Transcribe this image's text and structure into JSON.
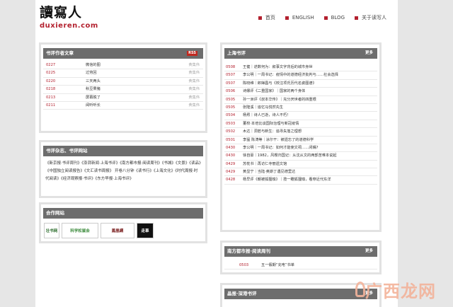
{
  "site": {
    "logo_cn": "讀寫人",
    "logo_en": "duxieren.com"
  },
  "nav": [
    {
      "label": "首页"
    },
    {
      "label": "ENGLISH"
    },
    {
      "label": "BLOG"
    },
    {
      "label": "关于读写人"
    }
  ],
  "reviews": {
    "title": "书评作者文章",
    "rss": "RSS",
    "items": [
      {
        "date": "0227",
        "title": "微信的图",
        "author": "黄集伟"
      },
      {
        "date": "0225",
        "title": "过劳回",
        "author": "黄集伟"
      },
      {
        "date": "0220",
        "title": "三天两头",
        "author": "黄集伟"
      },
      {
        "date": "0218",
        "title": "秋豆果猪",
        "author": "黄集伟"
      },
      {
        "date": "0213",
        "title": "屏幕脱了",
        "author": "黄集伟"
      },
      {
        "date": "0211",
        "title": "阅听听长",
        "author": "黄集伟"
      }
    ]
  },
  "magazines": {
    "title": "书评杂志、书评网站",
    "text": "《新京报·书评周刊》《澎湃新闻·上海书评》《南方都市报·阅读周刊》《书城》《文景》《读品》《中国独立阅读报告》《文汇读书周报》 开卷八分钟《读书行》《上海文化》《时代周报·时代阅读》《经济观察报·书评》《东方早报·上海书评》"
  },
  "partners": {
    "title": "合作网站",
    "items": [
      {
        "label": "壮书网"
      },
      {
        "label": "科学松鼠会"
      },
      {
        "label": "鳳凰網"
      },
      {
        "label": "走車"
      }
    ]
  },
  "shanghai": {
    "title": "上海书评",
    "more": "更多",
    "items": [
      {
        "date": "0508",
        "title": "王健｜述数何为：叙事文字背后的城市身世"
      },
      {
        "date": "0507",
        "title": "李公明｜一周书记：疫情中的道德经济批判与……社会选择"
      },
      {
        "date": "0507",
        "title": "陈晓维｜郎婵昌与《校注项氏历代名瓷图谱》"
      },
      {
        "date": "0506",
        "title": "诗娜评《二重国家》｜国家的两个身体"
      },
      {
        "date": "0505",
        "title": "孙一洲评《叔本华传》｜充分厌世者的四重根"
      },
      {
        "date": "0505",
        "title": "张隆溪｜追忆马悦然先生"
      },
      {
        "date": "0504",
        "title": "杨焄｜诗人已逝，诗人不朽！"
      },
      {
        "date": "0503",
        "title": "董校·本培比谈国际治理与新冠疫情"
      },
      {
        "date": "0502",
        "title": "木达｜洞若与新生：追寻失落之理想"
      },
      {
        "date": "0501",
        "title": "李猛 陈涛等｜涂尔干：被遗忘了的道德科学"
      },
      {
        "date": "0430",
        "title": "李公明｜一周书记：如何才能使文祠……闭嘴?"
      },
      {
        "date": "0430",
        "title": "徐自豪｜1982，风樱归国记：从沈从文的两部苦难本说起"
      },
      {
        "date": "0429",
        "title": "苏枕书｜再访仁寺丽遗文馆"
      },
      {
        "date": "0429",
        "title": "黄显宁｜当陆·奥斯丁遇见德里达"
      },
      {
        "date": "0428",
        "title": "杨早评《朝被狐狸嗅》｜揽一瞻狐狸嗅，看穿近代东洋"
      }
    ]
  },
  "southern": {
    "title": "南方都市报·阅读周刊",
    "more": "更多",
    "items": [
      {
        "date": "0503",
        "title": "五一假期“充电”书单"
      }
    ]
  },
  "beijing": {
    "title": "晶报·深港书评",
    "more": "更多"
  },
  "watermark": {
    "text": "广西龙网"
  }
}
